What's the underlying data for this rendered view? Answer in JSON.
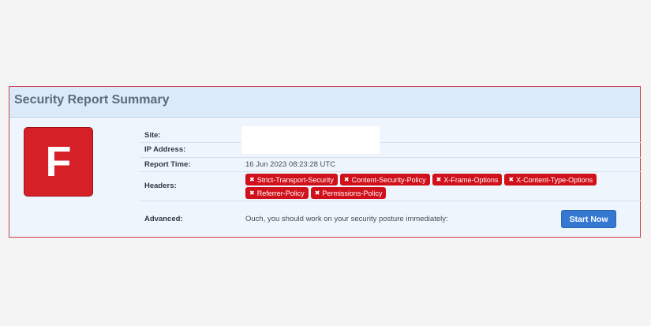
{
  "report": {
    "title": "Security Report Summary",
    "grade": "F",
    "site_label": "Site:",
    "site_value": "",
    "ip_label": "IP Address:",
    "ip_value": "",
    "time_label": "Report Time:",
    "time_value": "16 Jun 2023 08:23:28 UTC",
    "headers_label": "Headers:",
    "headers": [
      "Strict-Transport-Security",
      "Content-Security-Policy",
      "X-Frame-Options",
      "X-Content-Type-Options",
      "Referrer-Policy",
      "Permissions-Policy"
    ],
    "advanced_label": "Advanced:",
    "advanced_text": "Ouch, you should work on your security posture immediately:",
    "start_button": "Start Now"
  },
  "colors": {
    "grade_bg": "#d62027",
    "tag_bg": "#d0101a",
    "button_bg": "#3578d1",
    "panel_border": "#c9404a"
  }
}
